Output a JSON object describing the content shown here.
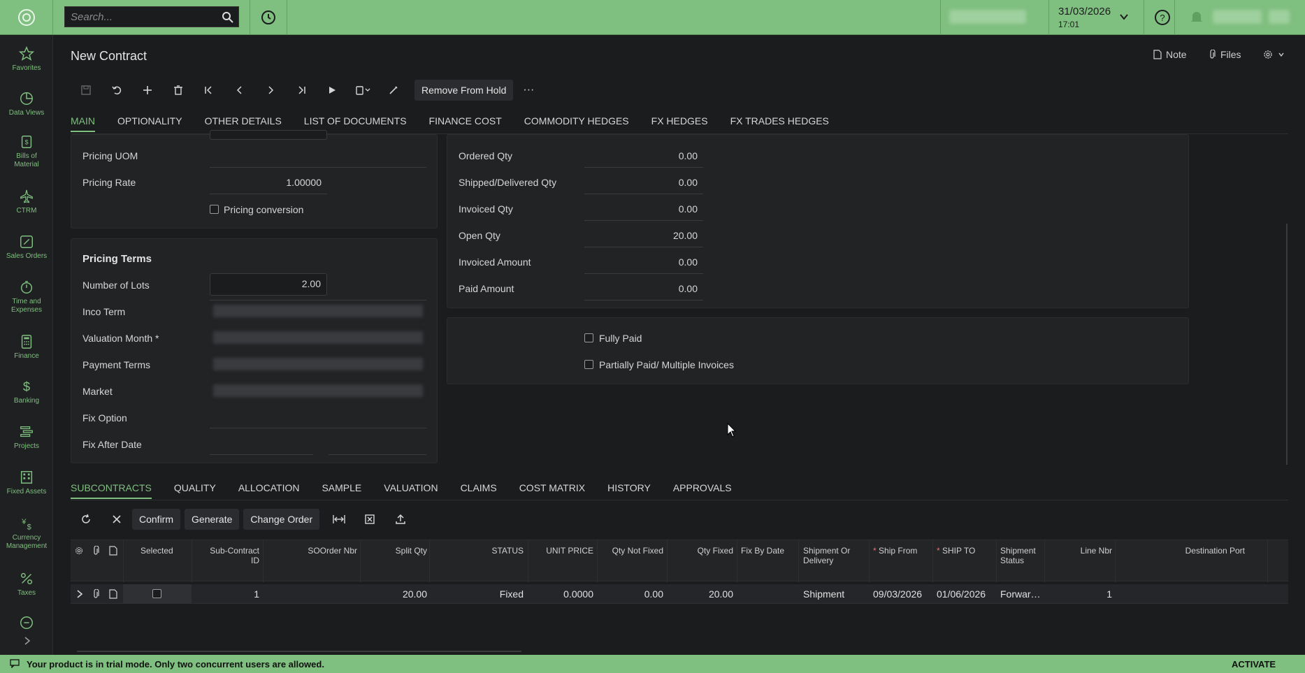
{
  "topbar": {
    "search_placeholder": "Search...",
    "date": "31/03/2026",
    "time": "17:01"
  },
  "sidebar": {
    "items": [
      {
        "label": "Favorites",
        "icon": "star-icon"
      },
      {
        "label": "Data Views",
        "icon": "pie-chart-icon"
      },
      {
        "label": "Bills of Material",
        "icon": "clipboard-icon"
      },
      {
        "label": "CTRM",
        "icon": "airplane-icon"
      },
      {
        "label": "Sales Orders",
        "icon": "pencil-square-icon"
      },
      {
        "label": "Time and Expenses",
        "icon": "stopwatch-icon"
      },
      {
        "label": "Finance",
        "icon": "calculator-icon"
      },
      {
        "label": "Banking",
        "icon": "dollar-icon"
      },
      {
        "label": "Projects",
        "icon": "list-bars-icon"
      },
      {
        "label": "Fixed Assets",
        "icon": "building-icon"
      },
      {
        "label": "Currency Management",
        "icon": "currency-icon"
      },
      {
        "label": "Taxes",
        "icon": "percent-icon"
      }
    ]
  },
  "page": {
    "title": "New Contract",
    "note_label": "Note",
    "files_label": "Files"
  },
  "toolbar": {
    "remove_from_hold": "Remove From Hold",
    "more": "···"
  },
  "tabs": [
    "MAIN",
    "OPTIONALITY",
    "OTHER DETAILS",
    "LIST OF DOCUMENTS",
    "FINANCE COST",
    "COMMODITY HEDGES",
    "FX HEDGES",
    "FX TRADES HEDGES"
  ],
  "pricing": {
    "uom_label": "Pricing UOM",
    "rate_label": "Pricing Rate",
    "rate_value": "1.00000",
    "conversion_label": "Pricing conversion"
  },
  "pricing_terms": {
    "title": "Pricing Terms",
    "lots_label": "Number of Lots",
    "lots_value": "2.00",
    "inco_label": "Inco Term",
    "valuation_label": "Valuation Month *",
    "payment_label": "Payment Terms",
    "market_label": "Market",
    "fix_option_label": "Fix Option",
    "fix_after_label": "Fix After Date"
  },
  "quantities": {
    "ordered_label": "Ordered Qty",
    "ordered_value": "0.00",
    "shipped_label": "Shipped/Delivered Qty",
    "shipped_value": "0.00",
    "invoiced_label": "Invoiced Qty",
    "invoiced_value": "0.00",
    "open_label": "Open Qty",
    "open_value": "20.00",
    "invoiced_amount_label": "Invoiced Amount",
    "invoiced_amount_value": "0.00",
    "paid_amount_label": "Paid Amount",
    "paid_amount_value": "0.00"
  },
  "payment_flags": {
    "fully_paid": "Fully Paid",
    "partially_paid": "Partially Paid/ Multiple Invoices"
  },
  "bottom_tabs": [
    "SUBCONTRACTS",
    "QUALITY",
    "ALLOCATION",
    "SAMPLE",
    "VALUATION",
    "CLAIMS",
    "COST MATRIX",
    "HISTORY",
    "APPROVALS"
  ],
  "grid_toolbar": {
    "confirm": "Confirm",
    "generate": "Generate",
    "change_order": "Change Order"
  },
  "grid": {
    "columns": {
      "selected": "Selected",
      "subcontract_id_1": "Sub-Contract",
      "subcontract_id_2": "ID",
      "soorder": "SOOrder Nbr",
      "split_qty": "Split Qty",
      "status": "STATUS",
      "unit_price": "UNIT PRICE",
      "qty_not_fixed": "Qty Not Fixed",
      "qty_fixed": "Qty Fixed",
      "fix_by_date": "Fix By Date",
      "shipment_or_delivery_1": "Shipment Or",
      "shipment_or_delivery_2": "Delivery",
      "ship_from": "Ship From",
      "ship_to": "SHIP TO",
      "shipment_status_1": "Shipment",
      "shipment_status_2": "Status",
      "line_nbr": "Line Nbr",
      "destination_port": "Destination Port"
    },
    "row": {
      "subcontract_id": "1",
      "split_qty": "20.00",
      "status": "Fixed",
      "unit_price": "0.0000",
      "qty_not_fixed": "0.00",
      "qty_fixed": "20.00",
      "shipment_or_delivery": "Shipment",
      "ship_from": "09/03/2026",
      "ship_to": "01/06/2026",
      "shipment_status": "Forwar…",
      "line_nbr": "1"
    }
  },
  "footer": {
    "message": "Your product is in trial mode. Only two concurrent users are allowed.",
    "activate": "ACTIVATE"
  },
  "colors": {
    "accent": "#7fbf7f",
    "background": "#1b1c1e",
    "panel": "#222325"
  }
}
